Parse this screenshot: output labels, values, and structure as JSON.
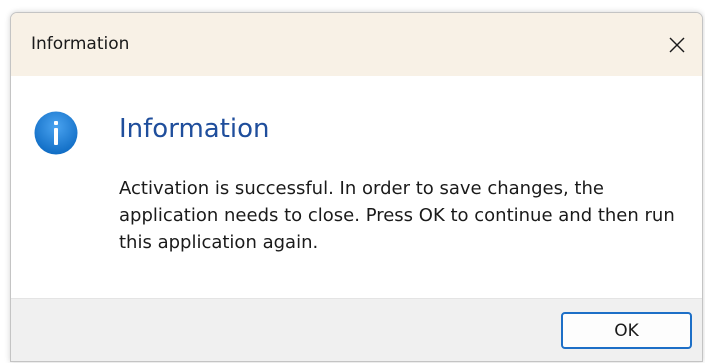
{
  "window": {
    "title": "Information"
  },
  "dialog": {
    "main_instruction": "Information",
    "message": "Activation is successful. In order to save changes, the application needs to close. Press OK to continue and then run this application again.",
    "icon": "info-icon"
  },
  "buttons": {
    "ok_label": "OK"
  },
  "colors": {
    "titlebar": "#f8f1e6",
    "accent": "#1d6fc7",
    "heading": "#1f4e9c",
    "footer": "#f0f0f0"
  }
}
